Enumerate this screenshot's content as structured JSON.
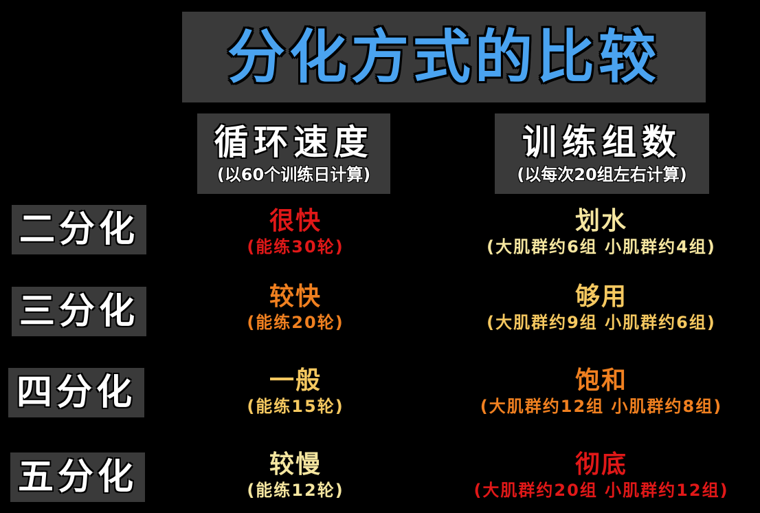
{
  "title": "分化方式的比较",
  "columns": [
    {
      "main": "循环速度",
      "sub": "(以60个训练日计算)"
    },
    {
      "main": "训练组数",
      "sub": "(以每次20组左右计算)"
    }
  ],
  "rows": [
    {
      "label": "二分化",
      "speed": {
        "main": "很快",
        "sub": "(能练30轮)",
        "color": "#e01818"
      },
      "sets": {
        "main": "划水",
        "sub": "(大肌群约6组  小肌群约4组)",
        "color": "#f5e6a0"
      }
    },
    {
      "label": "三分化",
      "speed": {
        "main": "较快",
        "sub": "(能练20轮)",
        "color": "#f08020"
      },
      "sets": {
        "main": "够用",
        "sub": "(大肌群约9组  小肌群约6组)",
        "color": "#f5c860"
      }
    },
    {
      "label": "四分化",
      "speed": {
        "main": "一般",
        "sub": "(能练15轮)",
        "color": "#f5c860"
      },
      "sets": {
        "main": "饱和",
        "sub": "(大肌群约12组  小肌群约8组)",
        "color": "#f08020"
      }
    },
    {
      "label": "五分化",
      "speed": {
        "main": "较慢",
        "sub": "(能练12轮)",
        "color": "#f5e6a0"
      },
      "sets": {
        "main": "彻底",
        "sub": "(大肌群约20组  小肌群约12组)",
        "color": "#e01818"
      }
    }
  ]
}
